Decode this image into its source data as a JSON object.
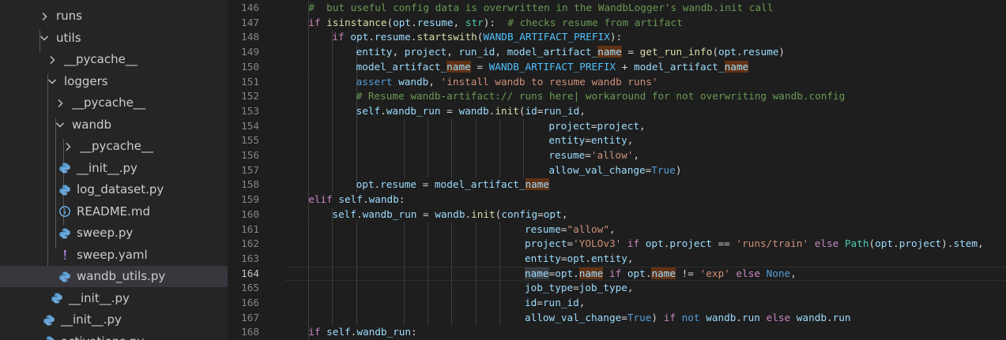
{
  "explorer": {
    "items": [
      {
        "label": "runs",
        "kind": "folder",
        "expanded": false,
        "icon": "chevron-right-icon",
        "indent": 48
      },
      {
        "label": "utils",
        "kind": "folder",
        "expanded": true,
        "icon": "chevron-down-icon",
        "indent": 48
      },
      {
        "label": "__pycache__",
        "kind": "folder",
        "expanded": false,
        "icon": "chevron-right-icon",
        "indent": 58
      },
      {
        "label": "loggers",
        "kind": "folder",
        "expanded": true,
        "icon": "chevron-down-icon",
        "indent": 58
      },
      {
        "label": "__pycache__",
        "kind": "folder",
        "expanded": false,
        "icon": "chevron-right-icon",
        "indent": 68
      },
      {
        "label": "wandb",
        "kind": "folder",
        "expanded": true,
        "icon": "chevron-down-icon",
        "indent": 68
      },
      {
        "label": "__pycache__",
        "kind": "folder",
        "expanded": false,
        "icon": "chevron-right-icon",
        "indent": 78
      },
      {
        "label": "__init__.py",
        "kind": "file",
        "icon": "python-icon",
        "indent": 74
      },
      {
        "label": "log_dataset.py",
        "kind": "file",
        "icon": "python-icon",
        "indent": 74
      },
      {
        "label": "README.md",
        "kind": "file",
        "icon": "info-icon",
        "indent": 74
      },
      {
        "label": "sweep.py",
        "kind": "file",
        "icon": "python-icon",
        "indent": 74
      },
      {
        "label": "sweep.yaml",
        "kind": "file",
        "icon": "yaml-icon",
        "indent": 74
      },
      {
        "label": "wandb_utils.py",
        "kind": "file",
        "icon": "python-icon",
        "indent": 74,
        "selected": true
      },
      {
        "label": "__init__.py",
        "kind": "file",
        "icon": "python-icon",
        "indent": 64
      },
      {
        "label": "__init__.py",
        "kind": "file",
        "icon": "python-icon",
        "indent": 54
      },
      {
        "label": "activations.py",
        "kind": "file",
        "icon": "python-icon",
        "indent": 54
      }
    ]
  },
  "editor": {
    "active_line": 164,
    "colors": {
      "keyword": "#c586c0",
      "func": "#dcdcaa",
      "var": "#9cdcfe",
      "str": "#ce9178",
      "comment": "#6a9955",
      "const": "#4fc1ff",
      "class": "#4ec9b0",
      "bool": "#569cd6",
      "plain": "#d4d4d4"
    },
    "lines": [
      {
        "n": "146",
        "indent": 1,
        "guides": [
          2
        ],
        "tokens": [
          [
            "#  but useful config data is overwritten in the WandbLogger's wandb.init call",
            "comment"
          ]
        ]
      },
      {
        "n": "147",
        "indent": 1,
        "guides": [
          2
        ],
        "tokens": [
          [
            "if ",
            "keyword"
          ],
          [
            "isinstance",
            "func"
          ],
          [
            "(",
            "plain"
          ],
          [
            "opt",
            "var"
          ],
          [
            ".",
            "plain"
          ],
          [
            "resume",
            "var"
          ],
          [
            ", ",
            "plain"
          ],
          [
            "str",
            "class"
          ],
          [
            "):  ",
            "plain"
          ],
          [
            "# checks resume from artifact",
            "comment"
          ]
        ]
      },
      {
        "n": "148",
        "indent": 2,
        "guides": [
          2,
          3
        ],
        "tokens": [
          [
            "if ",
            "keyword"
          ],
          [
            "opt",
            "var"
          ],
          [
            ".",
            "plain"
          ],
          [
            "resume",
            "var"
          ],
          [
            ".",
            "plain"
          ],
          [
            "startswith",
            "func"
          ],
          [
            "(",
            "plain"
          ],
          [
            "WANDB_ARTIFACT_PREFIX",
            "const"
          ],
          [
            "):",
            "plain"
          ]
        ]
      },
      {
        "n": "149",
        "indent": 3,
        "guides": [
          2,
          3,
          4
        ],
        "tokens": [
          [
            "entity",
            "var"
          ],
          [
            ", ",
            "plain"
          ],
          [
            "project",
            "var"
          ],
          [
            ", ",
            "plain"
          ],
          [
            "run_id",
            "var"
          ],
          [
            ", ",
            "plain"
          ],
          [
            "model_artifact_",
            "var"
          ],
          [
            "name",
            "var",
            "hl"
          ],
          [
            " = ",
            "plain"
          ],
          [
            "get_run_info",
            "func"
          ],
          [
            "(",
            "plain"
          ],
          [
            "opt",
            "var"
          ],
          [
            ".",
            "plain"
          ],
          [
            "resume",
            "var"
          ],
          [
            ")",
            "plain"
          ]
        ]
      },
      {
        "n": "150",
        "indent": 3,
        "guides": [
          2,
          3,
          4
        ],
        "tokens": [
          [
            "model_artifact_",
            "var"
          ],
          [
            "name",
            "var",
            "hl"
          ],
          [
            " = ",
            "plain"
          ],
          [
            "WANDB_ARTIFACT_PREFIX",
            "const"
          ],
          [
            " + ",
            "plain"
          ],
          [
            "model_artifact_",
            "var"
          ],
          [
            "name",
            "var",
            "hl"
          ]
        ]
      },
      {
        "n": "151",
        "indent": 3,
        "guides": [
          2,
          3,
          4
        ],
        "tokens": [
          [
            "assert ",
            "bool"
          ],
          [
            "wandb",
            "var"
          ],
          [
            ", ",
            "plain"
          ],
          [
            "'install wandb to resume wandb runs'",
            "str"
          ]
        ]
      },
      {
        "n": "152",
        "indent": 3,
        "guides": [
          2,
          3,
          4
        ],
        "tokens": [
          [
            "# Resume wandb-artifact:// runs here| workaround for not overwriting wandb.config",
            "comment"
          ]
        ]
      },
      {
        "n": "153",
        "indent": 3,
        "guides": [
          2,
          3,
          4
        ],
        "tokens": [
          [
            "self",
            "var"
          ],
          [
            ".",
            "plain"
          ],
          [
            "wandb_run",
            "var"
          ],
          [
            " = ",
            "plain"
          ],
          [
            "wandb",
            "var"
          ],
          [
            ".",
            "plain"
          ],
          [
            "init",
            "func"
          ],
          [
            "(",
            "plain"
          ],
          [
            "id",
            "var"
          ],
          [
            "=",
            "plain"
          ],
          [
            "run_id",
            "var"
          ],
          [
            ",",
            "plain"
          ]
        ]
      },
      {
        "n": "154",
        "col": 44,
        "guides": [
          2,
          3,
          4,
          5,
          6,
          7,
          8,
          9,
          10
        ],
        "tokens": [
          [
            "project",
            "var"
          ],
          [
            "=",
            "plain"
          ],
          [
            "project",
            "var"
          ],
          [
            ",",
            "plain"
          ]
        ]
      },
      {
        "n": "155",
        "col": 44,
        "guides": [
          2,
          3,
          4,
          5,
          6,
          7,
          8,
          9,
          10
        ],
        "tokens": [
          [
            "entity",
            "var"
          ],
          [
            "=",
            "plain"
          ],
          [
            "entity",
            "var"
          ],
          [
            ",",
            "plain"
          ]
        ]
      },
      {
        "n": "156",
        "col": 44,
        "guides": [
          2,
          3,
          4,
          5,
          6,
          7,
          8,
          9,
          10
        ],
        "tokens": [
          [
            "resume",
            "var"
          ],
          [
            "=",
            "plain"
          ],
          [
            "'allow'",
            "str"
          ],
          [
            ",",
            "plain"
          ]
        ]
      },
      {
        "n": "157",
        "col": 44,
        "guides": [
          2,
          3,
          4,
          5,
          6,
          7,
          8,
          9,
          10
        ],
        "tokens": [
          [
            "allow_val_change",
            "var"
          ],
          [
            "=",
            "plain"
          ],
          [
            "True",
            "bool"
          ],
          [
            ")",
            "plain"
          ]
        ]
      },
      {
        "n": "158",
        "indent": 3,
        "guides": [
          2,
          3,
          4
        ],
        "tokens": [
          [
            "opt",
            "var"
          ],
          [
            ".",
            "plain"
          ],
          [
            "resume",
            "var"
          ],
          [
            " = ",
            "plain"
          ],
          [
            "model_artifact_",
            "var"
          ],
          [
            "name",
            "var",
            "hl"
          ]
        ]
      },
      {
        "n": "159",
        "indent": 1,
        "guides": [
          2
        ],
        "tokens": [
          [
            "elif ",
            "keyword"
          ],
          [
            "self",
            "var"
          ],
          [
            ".",
            "plain"
          ],
          [
            "wandb",
            "var"
          ],
          [
            ":",
            "plain"
          ]
        ]
      },
      {
        "n": "160",
        "indent": 2,
        "guides": [
          2,
          3
        ],
        "tokens": [
          [
            "self",
            "var"
          ],
          [
            ".",
            "plain"
          ],
          [
            "wandb_run",
            "var"
          ],
          [
            " = ",
            "plain"
          ],
          [
            "wandb",
            "var"
          ],
          [
            ".",
            "plain"
          ],
          [
            "init",
            "func"
          ],
          [
            "(",
            "plain"
          ],
          [
            "config",
            "var"
          ],
          [
            "=",
            "plain"
          ],
          [
            "opt",
            "var"
          ],
          [
            ",",
            "plain"
          ]
        ]
      },
      {
        "n": "161",
        "col": 40,
        "guides": [
          2,
          3,
          4,
          5,
          6,
          7,
          8,
          9
        ],
        "tokens": [
          [
            "resume",
            "var"
          ],
          [
            "=",
            "plain"
          ],
          [
            "\"allow\"",
            "str"
          ],
          [
            ",",
            "plain"
          ]
        ]
      },
      {
        "n": "162",
        "col": 40,
        "guides": [
          2,
          3,
          4,
          5,
          6,
          7,
          8,
          9
        ],
        "tokens": [
          [
            "project",
            "var"
          ],
          [
            "=",
            "plain"
          ],
          [
            "'YOLOv3'",
            "str"
          ],
          [
            " if ",
            "keyword"
          ],
          [
            "opt",
            "var"
          ],
          [
            ".",
            "plain"
          ],
          [
            "project",
            "var"
          ],
          [
            " == ",
            "plain"
          ],
          [
            "'runs/train'",
            "str"
          ],
          [
            " else ",
            "keyword"
          ],
          [
            "Path",
            "class"
          ],
          [
            "(",
            "plain"
          ],
          [
            "opt",
            "var"
          ],
          [
            ".",
            "plain"
          ],
          [
            "project",
            "var"
          ],
          [
            ").",
            "plain"
          ],
          [
            "stem",
            "var"
          ],
          [
            ",",
            "plain"
          ]
        ]
      },
      {
        "n": "163",
        "col": 40,
        "guides": [
          2,
          3,
          4,
          5,
          6,
          7,
          8,
          9
        ],
        "tokens": [
          [
            "entity",
            "var"
          ],
          [
            "=",
            "plain"
          ],
          [
            "opt",
            "var"
          ],
          [
            ".",
            "plain"
          ],
          [
            "entity",
            "var"
          ],
          [
            ",",
            "plain"
          ]
        ]
      },
      {
        "n": "164",
        "col": 40,
        "guides": [
          2,
          3,
          4,
          5,
          6,
          7,
          8,
          9
        ],
        "tokens": [
          [
            "name",
            "var",
            "sel"
          ],
          [
            "=",
            "plain"
          ],
          [
            "opt",
            "var"
          ],
          [
            ".",
            "plain"
          ],
          [
            "name",
            "var",
            "hl"
          ],
          [
            " if ",
            "keyword"
          ],
          [
            "opt",
            "var"
          ],
          [
            ".",
            "plain"
          ],
          [
            "name",
            "var",
            "hl"
          ],
          [
            " != ",
            "plain"
          ],
          [
            "'exp'",
            "str"
          ],
          [
            " else ",
            "keyword"
          ],
          [
            "None",
            "bool"
          ],
          [
            ",",
            "plain"
          ]
        ]
      },
      {
        "n": "165",
        "col": 40,
        "guides": [
          2,
          3,
          4,
          5,
          6,
          7,
          8,
          9
        ],
        "tokens": [
          [
            "job_type",
            "var"
          ],
          [
            "=",
            "plain"
          ],
          [
            "job_type",
            "var"
          ],
          [
            ",",
            "plain"
          ]
        ]
      },
      {
        "n": "166",
        "col": 40,
        "guides": [
          2,
          3,
          4,
          5,
          6,
          7,
          8,
          9
        ],
        "tokens": [
          [
            "id",
            "var"
          ],
          [
            "=",
            "plain"
          ],
          [
            "run_id",
            "var"
          ],
          [
            ",",
            "plain"
          ]
        ]
      },
      {
        "n": "167",
        "col": 40,
        "guides": [
          2,
          3,
          4,
          5,
          6,
          7,
          8,
          9
        ],
        "tokens": [
          [
            "allow_val_change",
            "var"
          ],
          [
            "=",
            "plain"
          ],
          [
            "True",
            "bool"
          ],
          [
            ") ",
            "plain"
          ],
          [
            "if ",
            "keyword"
          ],
          [
            "not ",
            "bool"
          ],
          [
            "wandb",
            "var"
          ],
          [
            ".",
            "plain"
          ],
          [
            "run",
            "var"
          ],
          [
            " else ",
            "keyword"
          ],
          [
            "wandb",
            "var"
          ],
          [
            ".",
            "plain"
          ],
          [
            "run",
            "var"
          ]
        ]
      },
      {
        "n": "168",
        "indent": 1,
        "guides": [
          2
        ],
        "tokens": [
          [
            "if ",
            "keyword"
          ],
          [
            "self",
            "var"
          ],
          [
            ".",
            "plain"
          ],
          [
            "wandb_run",
            "var"
          ],
          [
            ":",
            "plain"
          ]
        ]
      }
    ]
  }
}
